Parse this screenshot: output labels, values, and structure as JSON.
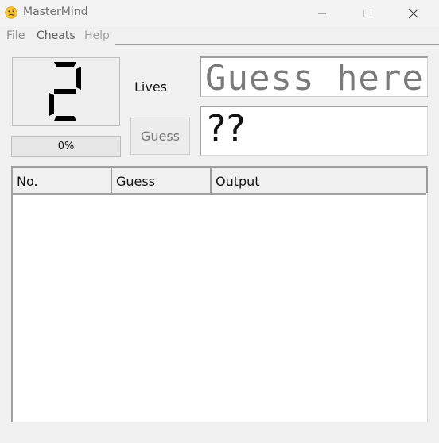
{
  "window": {
    "title": "MasterMind",
    "icon": "confused-face-icon"
  },
  "menu": {
    "file": "File",
    "cheats": "Cheats",
    "help": "Help"
  },
  "game": {
    "lives_value": 2,
    "lives_label": "Lives",
    "progress_percent": 0,
    "progress_label": "0%",
    "guess_button": "Guess",
    "guess_placeholder": "Guess here",
    "output_text": "??"
  },
  "table": {
    "columns": [
      "No.",
      "Guess",
      "Output"
    ],
    "rows": []
  },
  "colors": {
    "background": "#f0f0f0",
    "progress_fill": "#06b025"
  }
}
